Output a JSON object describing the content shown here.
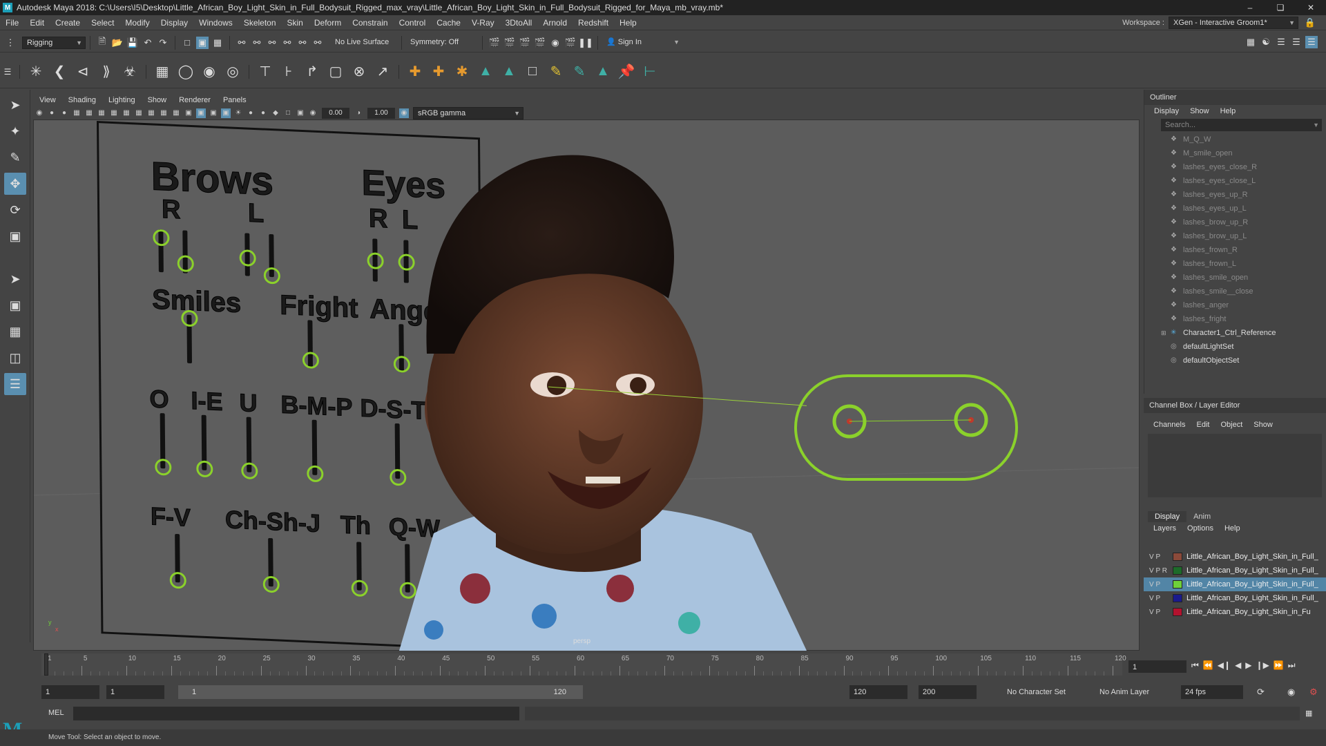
{
  "titlebar": {
    "title": "Autodesk Maya 2018: C:\\Users\\I5\\Desktop\\Little_African_Boy_Light_Skin_in_Full_Bodysuit_Rigged_max_vray\\Little_African_Boy_Light_Skin_in_Full_Bodysuit_Rigged_for_Maya_mb_vray.mb*",
    "logo": "M"
  },
  "menubar": {
    "items": [
      "File",
      "Edit",
      "Create",
      "Select",
      "Modify",
      "Display",
      "Windows",
      "Skeleton",
      "Skin",
      "Deform",
      "Constrain",
      "Control",
      "Cache",
      "V-Ray",
      "3DtoAll",
      "Arnold",
      "Redshift",
      "Help"
    ],
    "workspace_label": "Workspace :",
    "workspace_value": "XGen - Interactive Groom1*"
  },
  "statusline": {
    "mode": "Rigging",
    "live_surface": "No Live Surface",
    "symmetry": "Symmetry: Off",
    "sign_in": "Sign In"
  },
  "viewport": {
    "menu": [
      "View",
      "Shading",
      "Lighting",
      "Show",
      "Renderer",
      "Panels"
    ],
    "exposure": "0.00",
    "gamma": "1.00",
    "color_space": "sRGB gamma",
    "camera_label": "persp",
    "axis_y": "y",
    "axis_x": "x"
  },
  "board": {
    "brows": "Brows",
    "eyes": "Eyes",
    "r": "R",
    "l": "L",
    "smiles": "Smiles",
    "fright": "Fright",
    "anger": "Anger",
    "o": "O",
    "ie": "I-E",
    "u": "U",
    "bmp": "B-M-P",
    "dstz": "D-S-T-Z",
    "fv": "F-V",
    "chshj": "Ch-Sh-J",
    "th": "Th",
    "qw": "Q-W"
  },
  "outliner": {
    "title": "Outliner",
    "menu": [
      "Display",
      "Show",
      "Help"
    ],
    "search_placeholder": "Search...",
    "items": [
      "M_Q_W",
      "M_smile_open",
      "lashes_eyes_close_R",
      "lashes_eyes_close_L",
      "lashes_eyes_up_R",
      "lashes_eyes_up_L",
      "lashes_brow_up_R",
      "lashes_brow_up_L",
      "lashes_frown_R",
      "lashes_frown_L",
      "lashes_smile_open",
      "lashes_smile__close",
      "lashes_anger",
      "lashes_fright"
    ],
    "ctrl_ref": "Character1_Ctrl_Reference",
    "light_set": "defaultLightSet",
    "object_set": "defaultObjectSet"
  },
  "channelbox": {
    "title": "Channel Box / Layer Editor",
    "menu": [
      "Channels",
      "Edit",
      "Object",
      "Show"
    ]
  },
  "layers": {
    "tabs": [
      "Display",
      "Anim"
    ],
    "menu": [
      "Layers",
      "Options",
      "Help"
    ],
    "rows": [
      {
        "vp": "V  P",
        "name": "Little_African_Boy_Light_Skin_in_Full_",
        "color": "#8b4a3a"
      },
      {
        "vp": "V  P  R",
        "name": "Little_African_Boy_Light_Skin_in_Full_",
        "color": "#1d6b2a"
      },
      {
        "vp": "V  P",
        "name": "Little_African_Boy_Light_Skin_in_Full_",
        "color": "#6fd13a"
      },
      {
        "vp": "V  P",
        "name": "Little_African_Boy_Light_Skin_in_Full_",
        "color": "#1a1a8c"
      },
      {
        "vp": "V  P",
        "name": "Little_African_Boy_Light_Skin_in_Fu",
        "color": "#b3122e"
      }
    ]
  },
  "timeline": {
    "ticks": [
      "1",
      "5",
      "10",
      "15",
      "20",
      "25",
      "30",
      "35",
      "40",
      "45",
      "50",
      "55",
      "60",
      "65",
      "70",
      "75",
      "80",
      "85",
      "90",
      "95",
      "100",
      "105",
      "110",
      "115",
      "120"
    ],
    "current": "1"
  },
  "range": {
    "start": "1",
    "start2": "1",
    "slider_start": "1",
    "slider_end": "120",
    "end": "120",
    "end2": "200",
    "char_set": "No Character Set",
    "anim_layer": "No Anim Layer",
    "fps": "24 fps"
  },
  "cmd": {
    "lang": "MEL",
    "help": "Move Tool: Select an object to move."
  }
}
